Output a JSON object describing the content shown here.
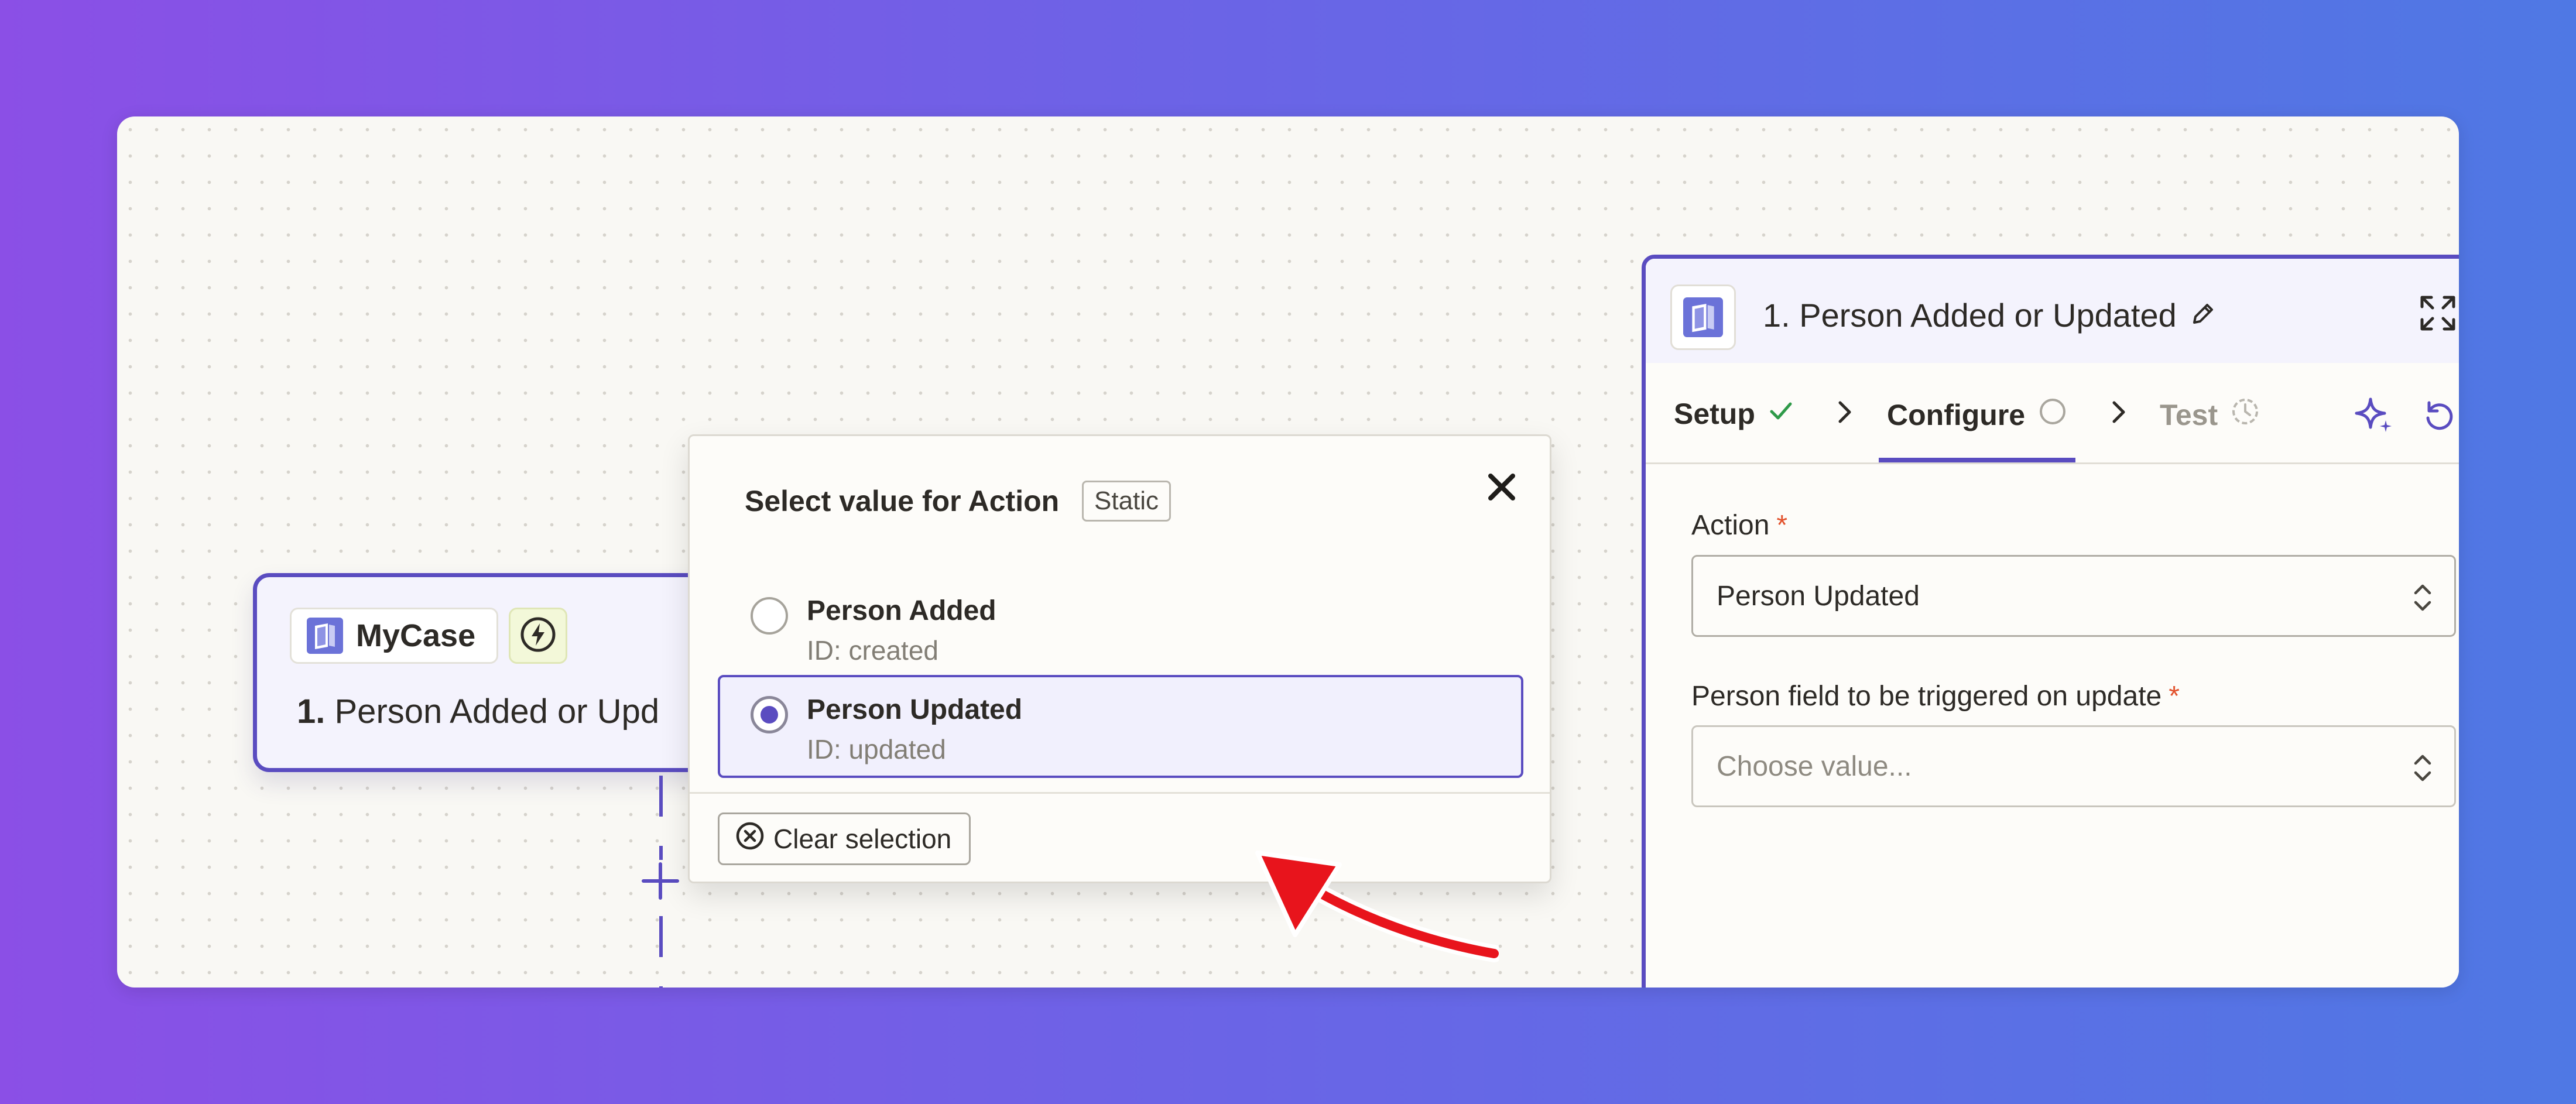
{
  "canvas": {
    "node": {
      "app_name": "MyCase",
      "step_number": "1.",
      "title": "Person Added or Upd"
    }
  },
  "popover": {
    "title": "Select value for Action",
    "badge": "Static",
    "options": [
      {
        "label": "Person Added",
        "sub": "ID: created",
        "selected": false
      },
      {
        "label": "Person Updated",
        "sub": "ID: updated",
        "selected": true
      }
    ],
    "clear_label": "Clear selection"
  },
  "panel": {
    "title": "1. Person Added or Updated",
    "tabs": [
      {
        "label": "Setup",
        "status": "complete"
      },
      {
        "label": "Configure",
        "status": "in-progress",
        "active": true
      },
      {
        "label": "Test",
        "status": "pending"
      }
    ],
    "fields": [
      {
        "label": "Action",
        "required_mark": "*",
        "value": "Person Updated"
      },
      {
        "label": "Person field to be triggered on update",
        "required_mark": "*",
        "placeholder": "Choose value..."
      }
    ]
  },
  "colors": {
    "accent": "#5a4cc0",
    "required": "#e2522d",
    "success": "#2e9a49",
    "annotation_arrow": "#e8141c"
  },
  "icons": [
    "mycase-logo-icon",
    "lightning-icon",
    "plus-icon",
    "close-icon",
    "radio-icon",
    "clear-circle-icon",
    "pencil-icon",
    "expand-icon",
    "check-icon",
    "chevron-right-icon",
    "ai-sparkle-icon",
    "undo-icon",
    "search-icon",
    "updown-chevron-icon",
    "more-vertical-icon"
  ]
}
